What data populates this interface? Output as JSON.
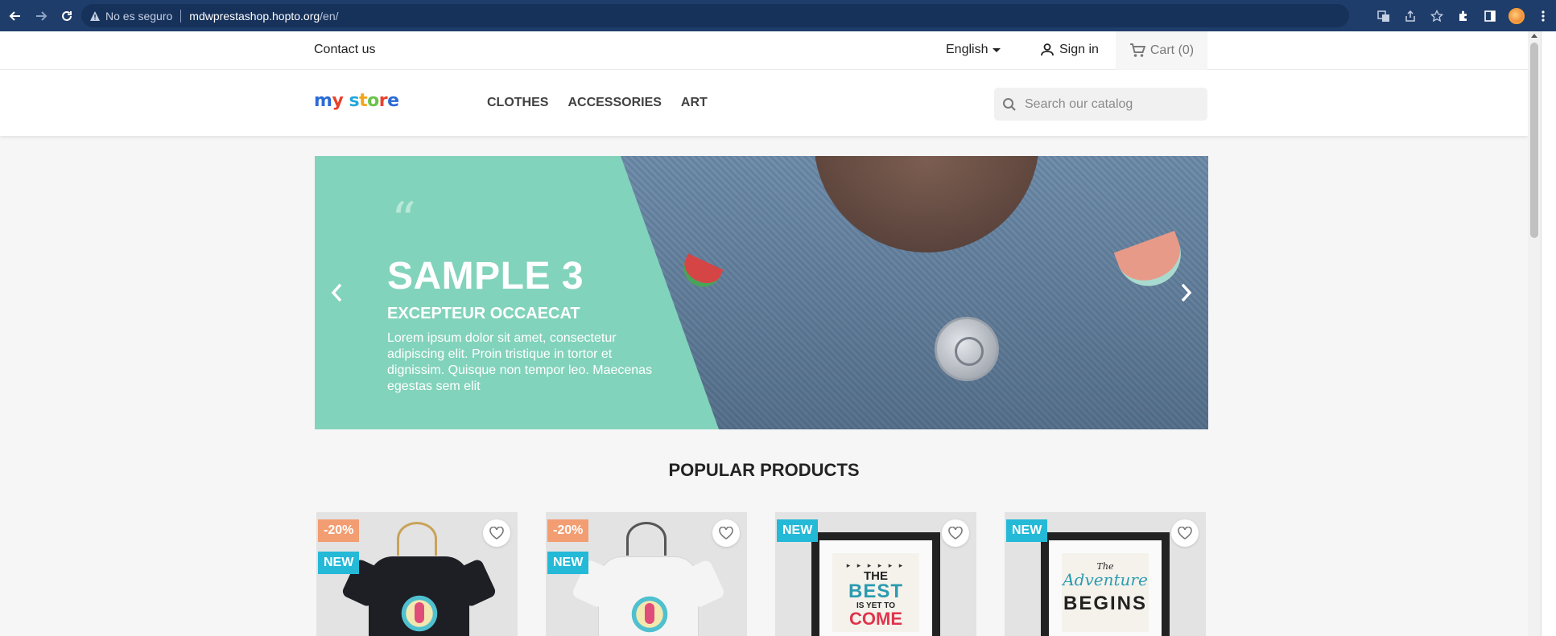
{
  "browser": {
    "security_label": "No es seguro",
    "url_host": "mdwprestashop.hopto.org",
    "url_path": "/en/"
  },
  "header": {
    "contact_label": "Contact us",
    "language": "English",
    "signin_label": "Sign in",
    "cart_label": "Cart",
    "cart_count": "(0)"
  },
  "logo": {
    "my": "my",
    "store": "store"
  },
  "nav": {
    "items": [
      "CLOTHES",
      "ACCESSORIES",
      "ART"
    ]
  },
  "search": {
    "placeholder": "Search our catalog"
  },
  "slider": {
    "quote_mark": "“",
    "title": "SAMPLE 3",
    "subtitle": "EXCEPTEUR OCCAECAT",
    "text": "Lorem ipsum dolor sit amet, consectetur adipiscing elit. Proin tristique in tortor et dignissim. Quisque non tempor leo. Maecenas egestas sem elit"
  },
  "popular": {
    "title": "POPULAR PRODUCTS",
    "products": [
      {
        "discount": "-20%",
        "flag": "NEW"
      },
      {
        "discount": "-20%",
        "flag": "NEW"
      },
      {
        "flag": "NEW",
        "art_lines": [
          "▸ ▸ ▸ ▸ ▸ ▸",
          "THE",
          "BEST",
          "IS YET TO",
          "COME"
        ]
      },
      {
        "flag": "NEW",
        "art_lines": [
          "The",
          "Adventure",
          "BEGINS"
        ]
      }
    ]
  },
  "colors": {
    "slider_green": "#82d3bb",
    "badge_discount": "#f39d72",
    "badge_new": "#24b9d7",
    "browser_bar": "#1f3d6b"
  }
}
